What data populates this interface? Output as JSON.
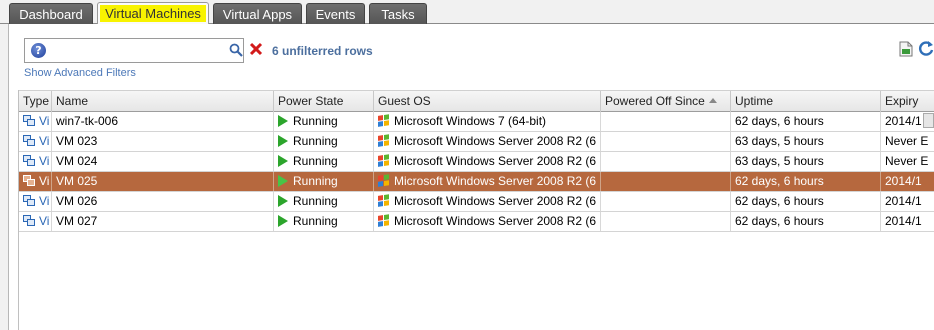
{
  "tabs": [
    {
      "label": "Dashboard"
    },
    {
      "label": "Virtual Machines"
    },
    {
      "label": "Virtual Apps"
    },
    {
      "label": "Events"
    },
    {
      "label": "Tasks"
    }
  ],
  "filter": {
    "search_value": "",
    "row_count_text": "6 unfilterred rows",
    "advanced_link": "Show Advanced Filters",
    "help_glyph": "?"
  },
  "columns": {
    "type": "Type",
    "name": "Name",
    "power": "Power State",
    "os": "Guest OS",
    "powered_off": "Powered Off Since",
    "uptime": "Uptime",
    "expiry": "Expiry"
  },
  "rows": [
    {
      "type": "Vi",
      "name": "win7-tk-006",
      "power": "Running",
      "os": "Microsoft Windows 7 (64-bit)",
      "powered_off": "",
      "uptime": "62 days, 6 hours",
      "expiry": "2014/1"
    },
    {
      "type": "Vi",
      "name": "VM 023",
      "power": "Running",
      "os": "Microsoft Windows Server 2008 R2 (6",
      "powered_off": "",
      "uptime": "63 days, 5 hours",
      "expiry": "Never E"
    },
    {
      "type": "Vi",
      "name": "VM 024",
      "power": "Running",
      "os": "Microsoft Windows Server 2008 R2 (6",
      "powered_off": "",
      "uptime": "63 days, 5 hours",
      "expiry": "Never E"
    },
    {
      "type": "Vi",
      "name": "VM 025",
      "power": "Running",
      "os": "Microsoft Windows Server 2008 R2 (6",
      "powered_off": "",
      "uptime": "62 days, 6 hours",
      "expiry": "2014/1"
    },
    {
      "type": "Vi",
      "name": "VM 026",
      "power": "Running",
      "os": "Microsoft Windows Server 2008 R2 (6",
      "powered_off": "",
      "uptime": "62 days, 6 hours",
      "expiry": "2014/1"
    },
    {
      "type": "Vi",
      "name": "VM 027",
      "power": "Running",
      "os": "Microsoft Windows Server 2008 R2 (6",
      "powered_off": "",
      "uptime": "62 days, 6 hours",
      "expiry": "2014/1"
    }
  ],
  "icons": {
    "vm": "vm-icon",
    "running": "play-icon",
    "os": "windows-logo-icon",
    "search": "search-icon",
    "clear": "clear-filter-icon",
    "export": "export-icon",
    "refresh": "refresh-icon"
  },
  "colors": {
    "selected_row": "#b6683e",
    "active_tab_highlight": "#f8f300",
    "running": "#2ca52c"
  }
}
